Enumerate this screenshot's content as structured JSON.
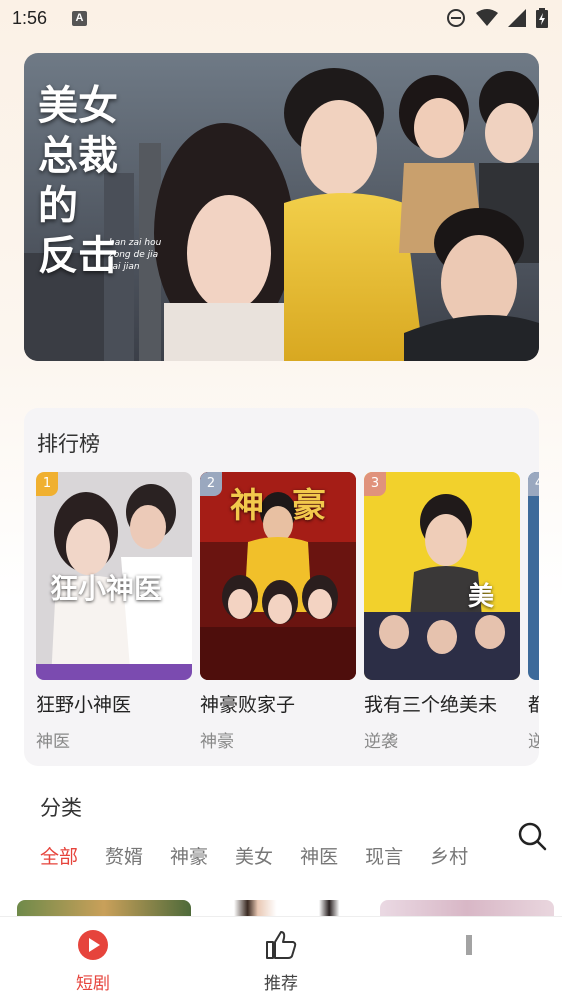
{
  "status_bar": {
    "time": "1:56",
    "notification_letter": "A"
  },
  "banner": {
    "title_lines": [
      "美女",
      "总裁",
      "的",
      "反击"
    ],
    "pinyin_lines": [
      "han zai hou",
      "zong de jia",
      "tai jian"
    ]
  },
  "ranking": {
    "title": "排行榜",
    "items": [
      {
        "rank": "1",
        "name": "狂野小神医",
        "tag": "神医",
        "poster_text": "狂小神医",
        "badge_color": "#f0b030"
      },
      {
        "rank": "2",
        "name": "神豪败家子",
        "tag": "神豪",
        "poster_text": "神豪",
        "badge_color": "#9aa8bf"
      },
      {
        "rank": "3",
        "name": "我有三个绝美未",
        "tag": "逆袭",
        "poster_text": "美",
        "badge_color": "#e0927c"
      },
      {
        "rank": "4",
        "name": "都",
        "tag": "逆",
        "poster_text": "",
        "badge_color": "#9aa8bf"
      }
    ]
  },
  "categories": {
    "title": "分类",
    "tabs": [
      "全部",
      "赘婿",
      "神豪",
      "美女",
      "神医",
      "现言",
      "乡村"
    ],
    "active_index": 0
  },
  "tabbar": {
    "items": [
      {
        "label": "短剧",
        "active": true
      },
      {
        "label": "推荐",
        "active": false
      }
    ]
  }
}
